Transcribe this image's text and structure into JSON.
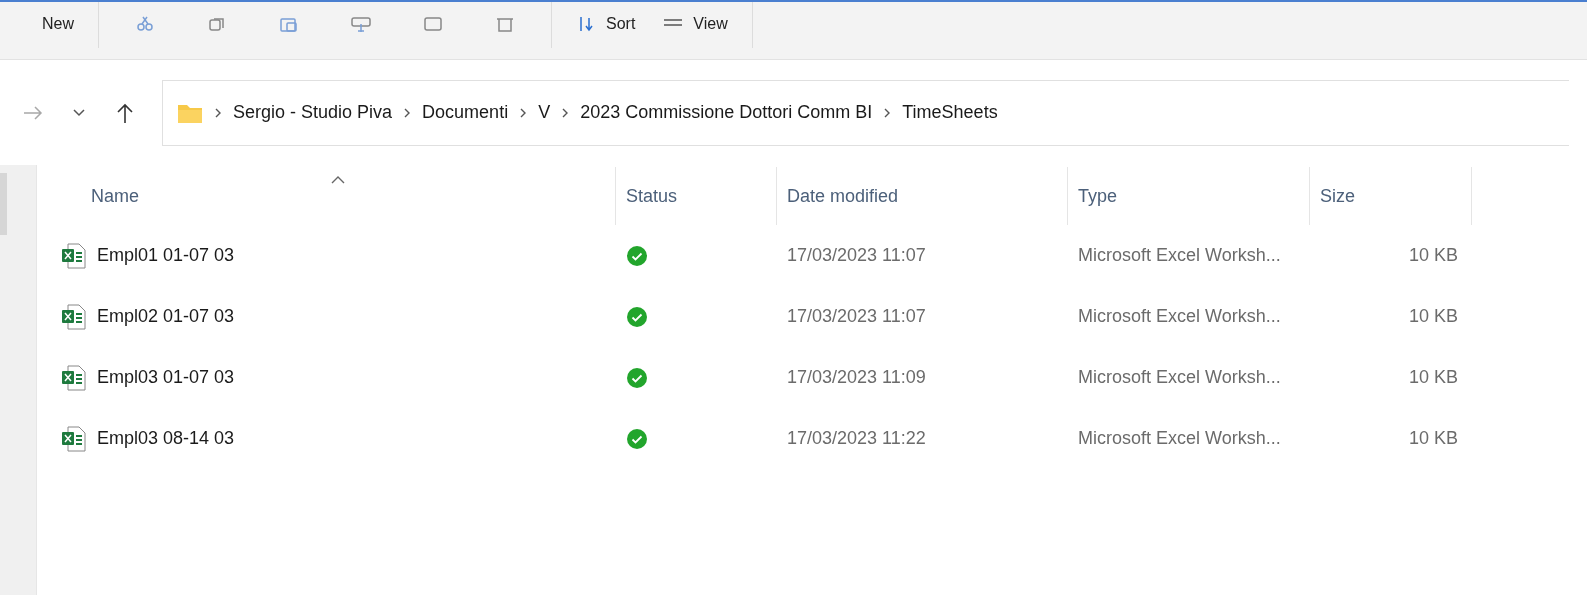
{
  "toolbar": {
    "items": [
      {
        "kind": "text",
        "label": "New"
      },
      {
        "kind": "icon"
      },
      {
        "kind": "icon"
      },
      {
        "kind": "icon"
      },
      {
        "kind": "icon"
      },
      {
        "kind": "icon"
      },
      {
        "kind": "icon"
      },
      {
        "kind": "text",
        "label": "Sort"
      },
      {
        "kind": "text",
        "label": "View"
      }
    ]
  },
  "navigation": {
    "forward_disabled": true
  },
  "address_bar": {
    "path": [
      "Sergio - Studio Piva",
      "Documenti",
      "V",
      "2023 Commissione Dottori Comm BI",
      "TimeSheets"
    ]
  },
  "table": {
    "columns": [
      {
        "label": "Name",
        "sorted": true
      },
      {
        "label": "Status",
        "sorted": false
      },
      {
        "label": "Date modified",
        "sorted": false
      },
      {
        "label": "Type",
        "sorted": false
      },
      {
        "label": "Size",
        "sorted": false
      }
    ],
    "rows": [
      {
        "name": "Empl01 01-07 03",
        "synced": true,
        "date": "17/03/2023 11:07",
        "type": "Microsoft Excel Worksh...",
        "size": "10 KB"
      },
      {
        "name": "Empl02 01-07 03",
        "synced": true,
        "date": "17/03/2023 11:07",
        "type": "Microsoft Excel Worksh...",
        "size": "10 KB"
      },
      {
        "name": "Empl03 01-07 03",
        "synced": true,
        "date": "17/03/2023 11:09",
        "type": "Microsoft Excel Worksh...",
        "size": "10 KB"
      },
      {
        "name": "Empl03 08-14 03",
        "synced": true,
        "date": "17/03/2023 11:22",
        "type": "Microsoft Excel Worksh...",
        "size": "10 KB"
      }
    ]
  }
}
